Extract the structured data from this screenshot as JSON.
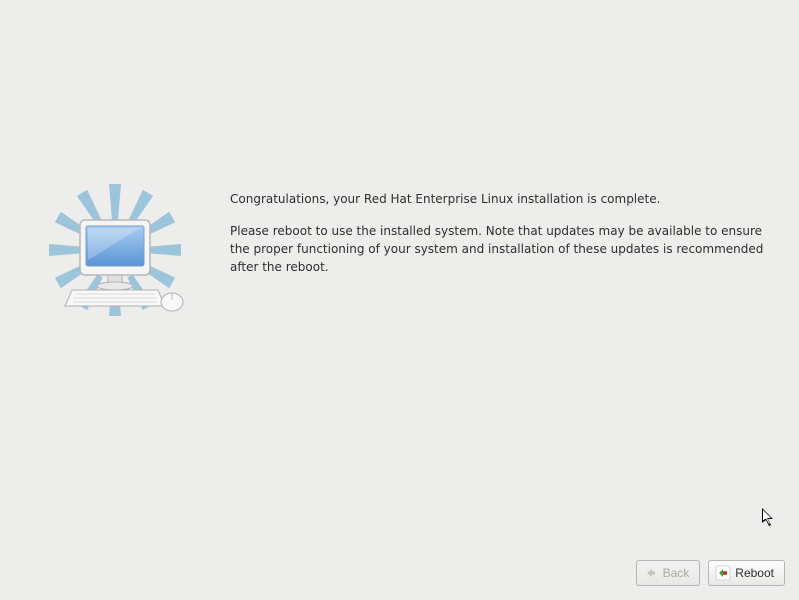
{
  "main": {
    "congrats_text": "Congratulations, your Red Hat Enterprise Linux installation is complete.",
    "instructions_text": "Please reboot to use the installed system.  Note that updates may be available to ensure the proper functioning of your system and installation of these updates is recommended after the reboot."
  },
  "buttons": {
    "back_label": "Back",
    "reboot_label": "Reboot"
  }
}
